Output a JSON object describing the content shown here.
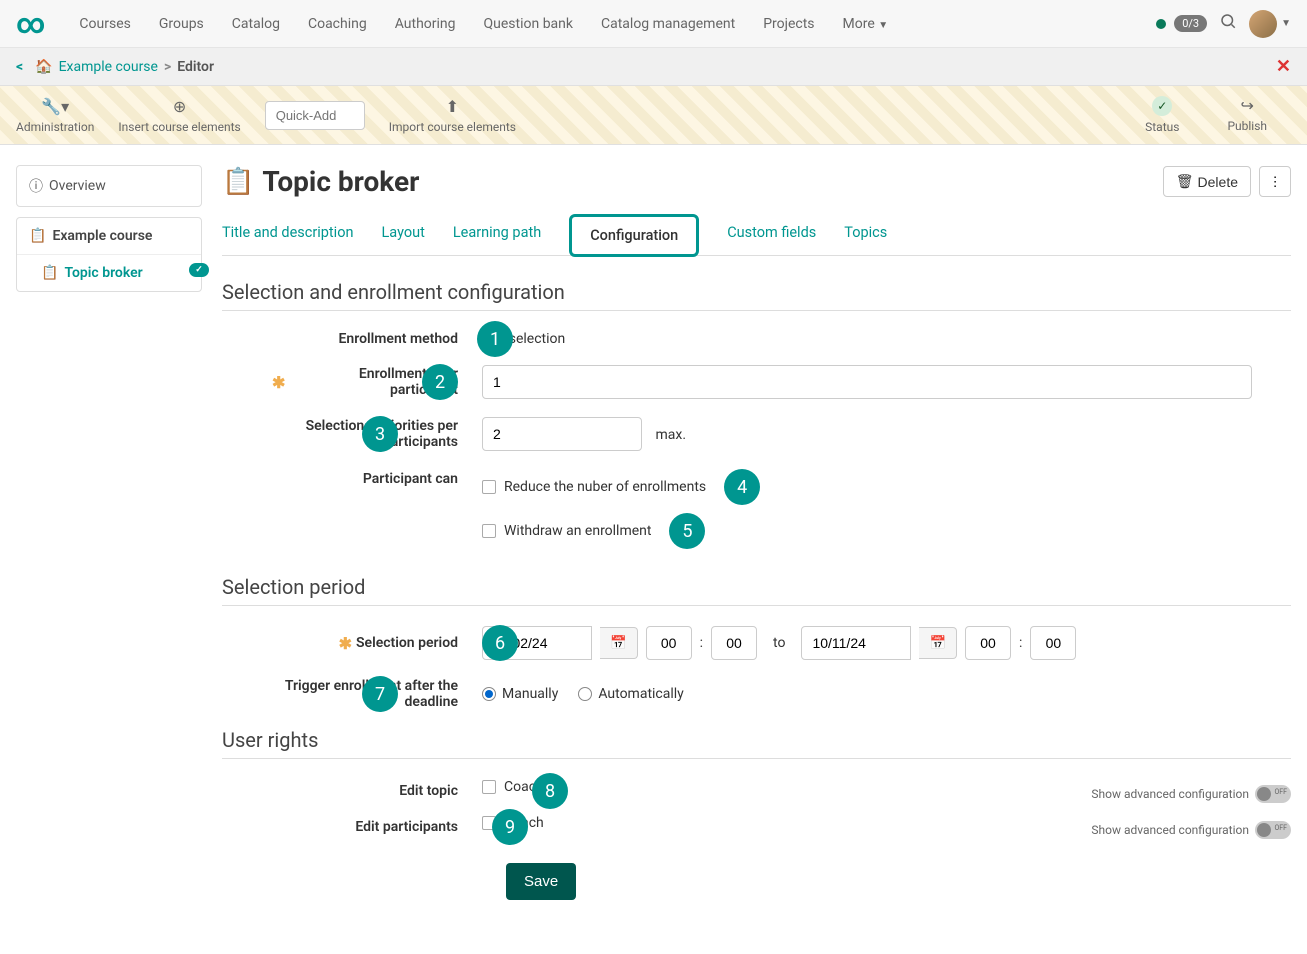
{
  "topnav": {
    "items": [
      "Courses",
      "Groups",
      "Catalog",
      "Coaching",
      "Authoring",
      "Question bank",
      "Catalog management",
      "Projects",
      "More"
    ],
    "badge": "0/3"
  },
  "breadcrumb": {
    "course": "Example course",
    "current": "Editor"
  },
  "toolbar": {
    "admin": "Administration",
    "insert": "Insert course elements",
    "quickadd_placeholder": "Quick-Add",
    "import": "Import course elements",
    "status": "Status",
    "publish": "Publish"
  },
  "sidebar": {
    "overview": "Overview",
    "course": "Example course",
    "node": "Topic broker"
  },
  "page": {
    "title": "Topic broker",
    "delete": "Delete"
  },
  "tabs": [
    "Title and description",
    "Layout",
    "Learning path",
    "Configuration",
    "Custom fields",
    "Topics"
  ],
  "sections": {
    "sel_enroll": "Selection and enrollment configuration",
    "sel_period": "Selection period",
    "user_rights": "User rights"
  },
  "fields": {
    "enroll_method": {
      "label": "Enrollment method",
      "value": "Fair selection"
    },
    "enroll_per": {
      "label": "Enrollments per participant",
      "value": "1"
    },
    "sel_per": {
      "label": "Selections/Priorities per participants",
      "value": "2",
      "suffix": "max."
    },
    "part_can": {
      "label": "Participant can",
      "opt1": "Reduce the nuber of enrollments",
      "opt2": "Withdraw an enrollment"
    },
    "period": {
      "label": "Selection period",
      "from_date": "10/02/24",
      "from_h": "00",
      "from_m": "00",
      "to": "to",
      "to_date": "10/11/24",
      "to_h": "00",
      "to_m": "00"
    },
    "trigger": {
      "label": "Trigger enrollment after the deadline",
      "opt1": "Manually",
      "opt2": "Automatically"
    },
    "edit_topic": {
      "label": "Edit topic",
      "opt": "Coach"
    },
    "edit_part": {
      "label": "Edit participants",
      "opt": "Coach"
    },
    "show_adv": "Show advanced configuration",
    "toggle_off": "OFF"
  },
  "badges": [
    "1",
    "2",
    "3",
    "4",
    "5",
    "6",
    "7",
    "8",
    "9"
  ],
  "save": "Save"
}
